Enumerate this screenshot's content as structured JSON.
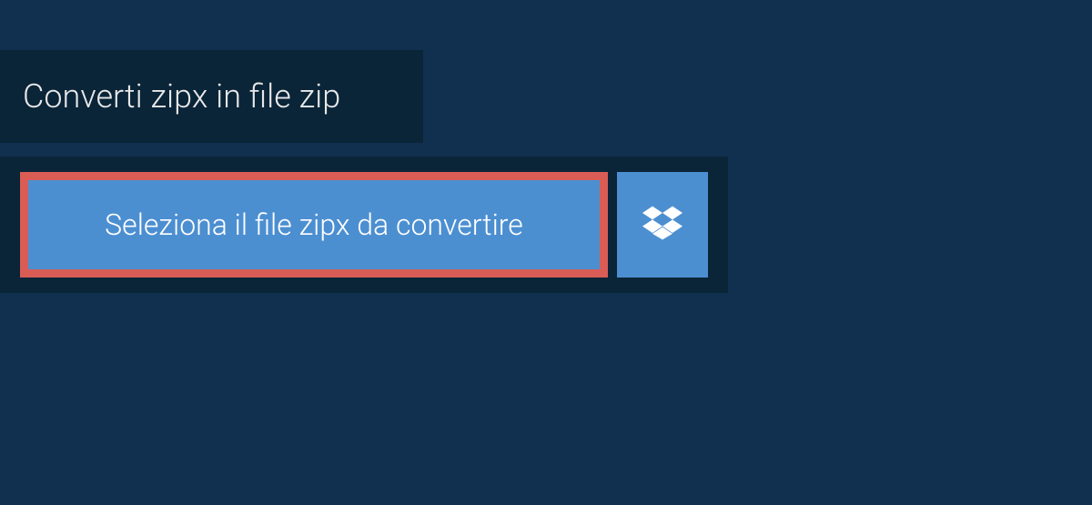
{
  "header": {
    "title": "Converti zipx in file zip"
  },
  "actions": {
    "select_file_label": "Seleziona il file zipx da convertire"
  }
}
